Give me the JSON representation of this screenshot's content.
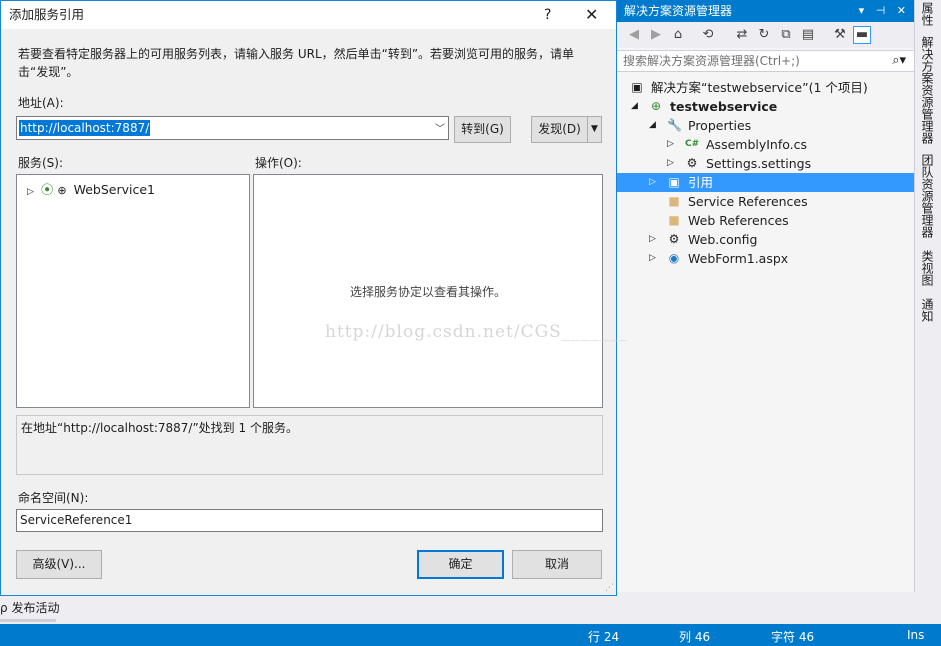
{
  "dialog": {
    "title": "添加服务引用",
    "help": "?",
    "close": "✕",
    "intro": "若要查看特定服务器上的可用服务列表，请输入服务 URL，然后单击“转到”。若要浏览可用的服务，请单击“发现”。",
    "address_label": "地址(A):",
    "address_value": "http://localhost:7887/",
    "go_button": "转到(G)",
    "discover_button": "发现(D)",
    "services_label": "服务(S):",
    "operations_label": "操作(O):",
    "services": [
      {
        "name": "WebService1"
      }
    ],
    "operations_placeholder": "选择服务协定以查看其操作。",
    "watermark": "http://blog.csdn.net/CGS_______",
    "status_message": "在地址“http://localhost:7887/”处找到 1 个服务。",
    "namespace_label": "命名空间(N):",
    "namespace_value": "ServiceReference1",
    "advanced_button": "高级(V)...",
    "ok_button": "确定",
    "cancel_button": "取消"
  },
  "solution_explorer": {
    "title": "解决方案资源管理器",
    "title_controls": "▾ ⊣ ✕",
    "search_placeholder": "搜索解决方案资源管理器(Ctrl+;)",
    "tree": [
      {
        "label": "解决方案“testwebservice”(1 个项目)",
        "icon": "solution-icon",
        "expanded": null
      },
      {
        "label": "testwebservice",
        "icon": "web-project-icon",
        "expanded": true,
        "bold": true
      },
      {
        "label": "Properties",
        "icon": "wrench-icon",
        "expanded": true
      },
      {
        "label": "AssemblyInfo.cs",
        "icon": "csharp-file-icon",
        "expanded": false
      },
      {
        "label": "Settings.settings",
        "icon": "gear-icon",
        "expanded": false
      },
      {
        "label": "引用",
        "icon": "references-icon",
        "expanded": false,
        "selected": true
      },
      {
        "label": "Service References",
        "icon": "folder-icon",
        "expanded": null
      },
      {
        "label": "Web References",
        "icon": "folder-icon",
        "expanded": null
      },
      {
        "label": "Web.config",
        "icon": "config-file-icon",
        "expanded": false
      },
      {
        "label": "WebForm1.aspx",
        "icon": "web-form-icon",
        "expanded": false
      }
    ]
  },
  "side_tabs": [
    "属性",
    "解决方案资源管理器",
    "团队资源管理器",
    "类视图",
    "通知"
  ],
  "ide": {
    "publish_activity": "发布活动",
    "status": {
      "line": "行 24",
      "col": "列 46",
      "char": "字符 46",
      "mode": "Ins"
    }
  },
  "colors": {
    "accent": "#007acc",
    "selection": "#3399ff",
    "dialog_border": "#1883d7"
  }
}
